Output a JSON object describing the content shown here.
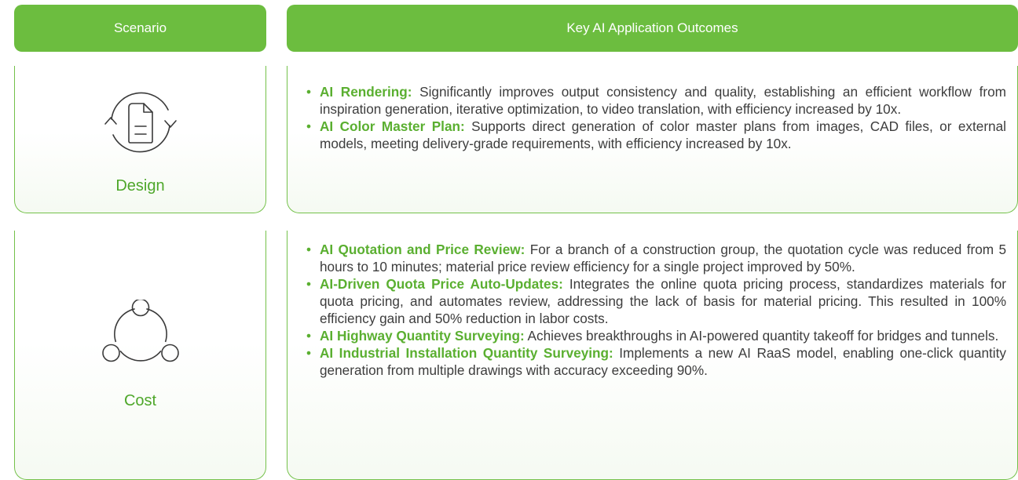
{
  "header": {
    "scenario": "Scenario",
    "outcomes": "Key AI Application Outcomes"
  },
  "rows": [
    {
      "scenario": "Design",
      "icon": "document-cycle-icon",
      "items": [
        {
          "title": "AI Rendering:",
          "text": "Significantly improves output consistency and quality, establishing an efficient workflow from inspiration generation, iterative optimization, to video translation, with efficiency increased by 10x."
        },
        {
          "title": "AI Color Master Plan:",
          "text": "Supports direct generation of color master plans from images, CAD files, or external models, meeting delivery-grade requirements, with efficiency increased by 10x."
        }
      ]
    },
    {
      "scenario": "Cost",
      "icon": "cycle-nodes-icon",
      "items": [
        {
          "title": "AI Quotation and Price Review:",
          "text": "For a branch of a construction group, the quotation cycle was reduced from 5 hours to 10 minutes; material price review efficiency for a single project improved by 50%."
        },
        {
          "title": "AI-Driven Quota Price Auto-Updates:",
          "text": "Integrates the online quota pricing process, standardizes materials for quota pricing, and automates review, addressing the lack of basis for material pricing. This resulted in 100% efficiency gain and 50% reduction in labor costs."
        },
        {
          "title": "AI Highway Quantity Surveying:",
          "text": "Achieves breakthroughs in AI-powered quantity takeoff for bridges and tunnels."
        },
        {
          "title": "AI Industrial Installation Quantity Surveying:",
          "text": "Implements a new AI RaaS model, enabling one-click quantity generation from multiple drawings with accuracy exceeding 90%."
        }
      ]
    }
  ],
  "colors": {
    "header_bg": "#6cbd3f",
    "accent": "#5aaf30",
    "border": "#74c14a",
    "body_text": "#3d3d3d"
  }
}
